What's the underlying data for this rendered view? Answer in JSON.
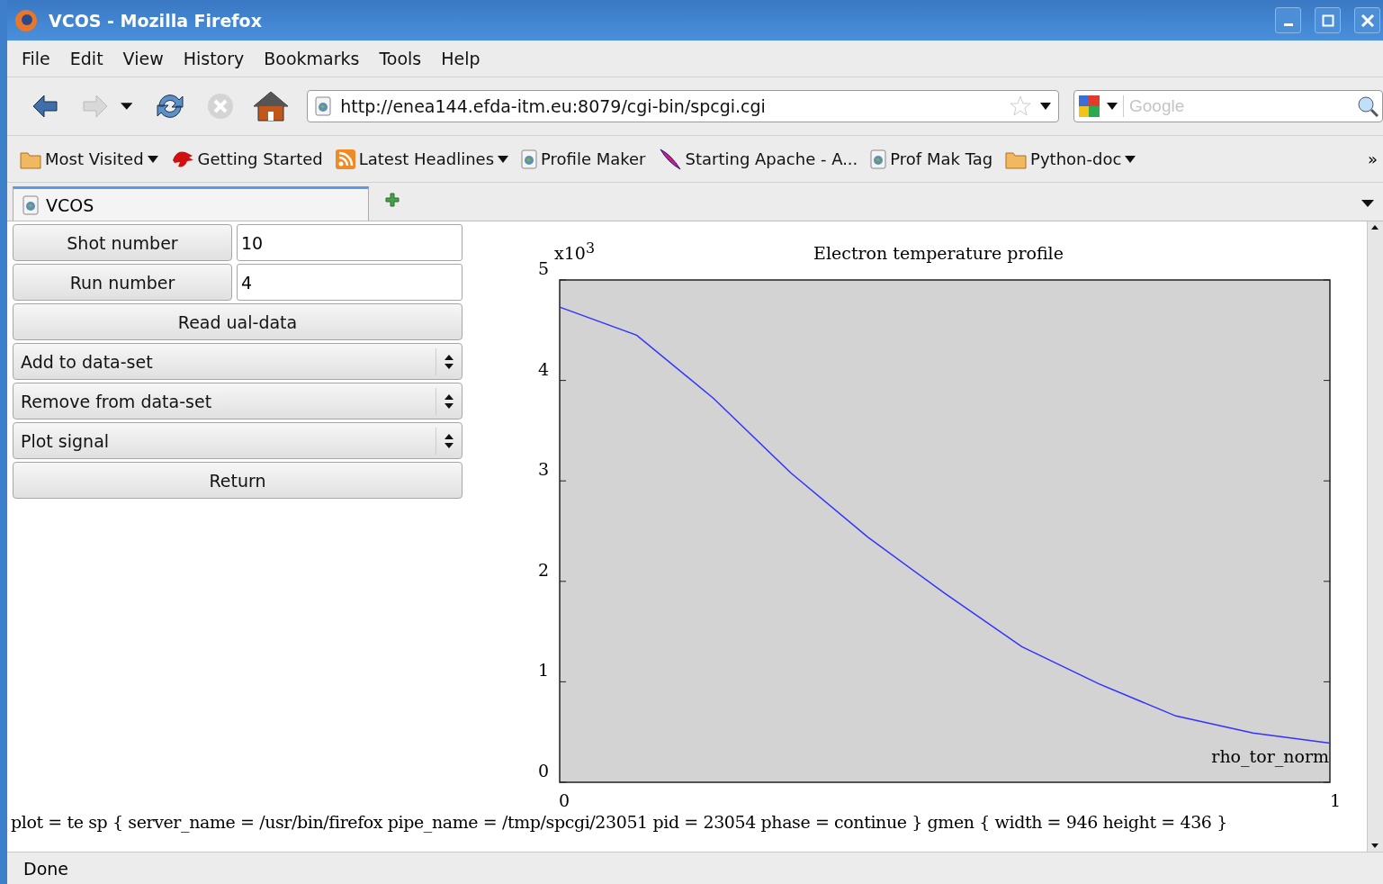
{
  "window": {
    "title": "VCOS - Mozilla Firefox"
  },
  "menu": [
    "File",
    "Edit",
    "View",
    "History",
    "Bookmarks",
    "Tools",
    "Help"
  ],
  "navigation": {
    "url": "http://enea144.efda-itm.eu:8079/cgi-bin/spcgi.cgi",
    "search_placeholder": "Google",
    "forward_disabled": true,
    "stop_disabled": true
  },
  "bookmarks": [
    {
      "kind": "folder",
      "label": "Most Visited",
      "menu": true
    },
    {
      "kind": "bug",
      "label": "Getting Started",
      "menu": false
    },
    {
      "kind": "feed",
      "label": "Latest Headlines",
      "menu": true
    },
    {
      "kind": "page",
      "label": "Profile Maker",
      "menu": false
    },
    {
      "kind": "feather",
      "label": "Starting Apache - A...",
      "menu": false
    },
    {
      "kind": "page",
      "label": "Prof Mak Tag",
      "menu": false
    },
    {
      "kind": "folder",
      "label": "Python-doc",
      "menu": true
    }
  ],
  "bookmarks_overflow": "»",
  "tabs": [
    {
      "label": "VCOS",
      "selected": true
    }
  ],
  "fields": [
    {
      "label": "Shot number",
      "value": "10"
    },
    {
      "label": "Run number",
      "value": "4"
    }
  ],
  "actions": [
    {
      "kind": "button",
      "label": "Read ual-data"
    },
    {
      "kind": "select",
      "label": "Add to data-set"
    },
    {
      "kind": "select",
      "label": "Remove from data-set"
    },
    {
      "kind": "select",
      "label": "Plot signal"
    },
    {
      "kind": "button",
      "label": "Return"
    }
  ],
  "chart": {
    "y_scale": "x10$^{3}$",
    "chart_data": {
      "type": "line",
      "title": "Electron temperature profile",
      "xlabel": "rho_tor_norm",
      "x": [
        0,
        0.1,
        0.2,
        0.3,
        0.4,
        0.5,
        0.6,
        0.7,
        0.8,
        0.9,
        1
      ],
      "series": [
        {
          "color": "#3333ff",
          "values": [
            4.73,
            4.45,
            3.82,
            3.08,
            2.44,
            1.88,
            1.35,
            0.98,
            0.66,
            0.49,
            0.39
          ]
        }
      ],
      "xlim": [
        0,
        1
      ],
      "ylim": [
        0,
        5
      ],
      "xticks": [
        0,
        1
      ],
      "yticks": [
        0,
        1,
        2,
        3,
        4,
        5
      ]
    }
  },
  "info": "plot = te sp { server_name = /usr/bin/firefox pipe_name = /tmp/spcgi/23051 pid = 23054 phase = continue } gmen { width = 946 height = 436 }",
  "status": "Done"
}
